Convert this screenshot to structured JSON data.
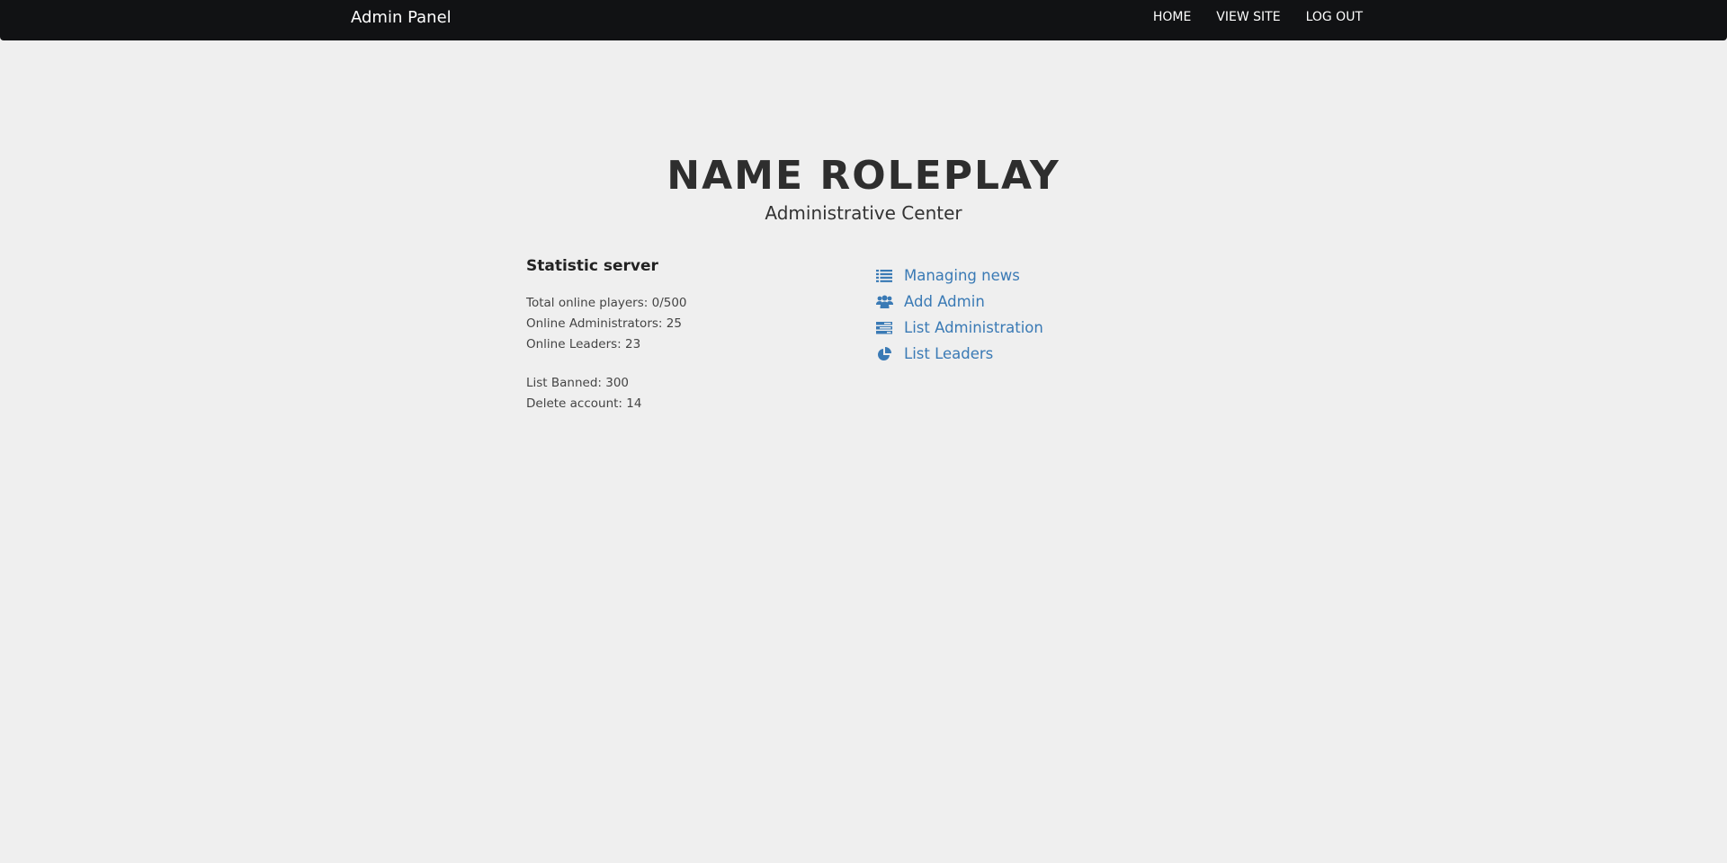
{
  "navbar": {
    "brand": "Admin Panel",
    "items": [
      {
        "label": "HOME"
      },
      {
        "label": "VIEW SITE"
      },
      {
        "label": "LOG OUT"
      }
    ]
  },
  "header": {
    "title": "Name Roleplay",
    "subtitle": "Administrative Center"
  },
  "stats": {
    "heading": "Statistic server",
    "lines": [
      "Total online players: 0/500",
      "Online Administrators: 25",
      "Online Leaders: 23"
    ],
    "lines2": [
      "List Banned: 300",
      "Delete account: 14"
    ]
  },
  "links": {
    "items": [
      {
        "label": "Managing news",
        "icon": "list-icon"
      },
      {
        "label": "Add Admin",
        "icon": "users-icon"
      },
      {
        "label": "List Administration",
        "icon": "tasks-icon"
      },
      {
        "label": "List Leaders",
        "icon": "pie-chart-icon"
      }
    ]
  },
  "colors": {
    "navbar_bg": "#111214",
    "page_bg": "#efefef",
    "link": "#3a7ab5"
  }
}
